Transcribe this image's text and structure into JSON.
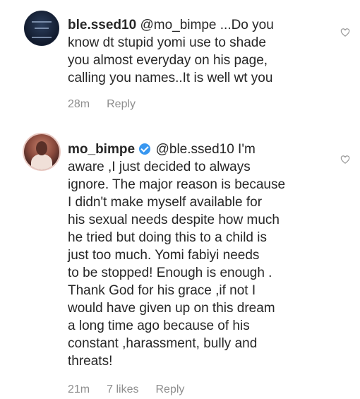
{
  "comments": [
    {
      "username": "ble.ssed10",
      "verified": false,
      "lines": [
        "@mo_bimpe ...Do you",
        "know dt stupid yomi use to shade",
        "you almost everyday on his page,",
        "calling you names..It is well wt you"
      ],
      "time": "28m",
      "likes": "",
      "reply_label": "Reply",
      "avatar_icon": "profile-avatar-icon",
      "like_icon": "heart-outline-icon"
    },
    {
      "username": "mo_bimpe",
      "verified": true,
      "first_line_rest": "@ble.ssed10 I'm",
      "lines": [
        "aware ,I just decided to always",
        "ignore.  The major reason is because",
        "I didn't make myself available for",
        "his sexual needs despite how much",
        "he tried but doing this to a child is",
        "just too much.  Yomi fabiyi needs",
        "to be stopped! Enough is enough .",
        "Thank God for his grace ,if not I",
        "would have given up on this dream",
        "a long time ago because of his",
        "constant ,harassment, bully and",
        "threats!"
      ],
      "time": "21m",
      "likes": "7 likes",
      "reply_label": "Reply",
      "avatar_icon": "profile-avatar-icon",
      "like_icon": "heart-outline-icon"
    }
  ]
}
